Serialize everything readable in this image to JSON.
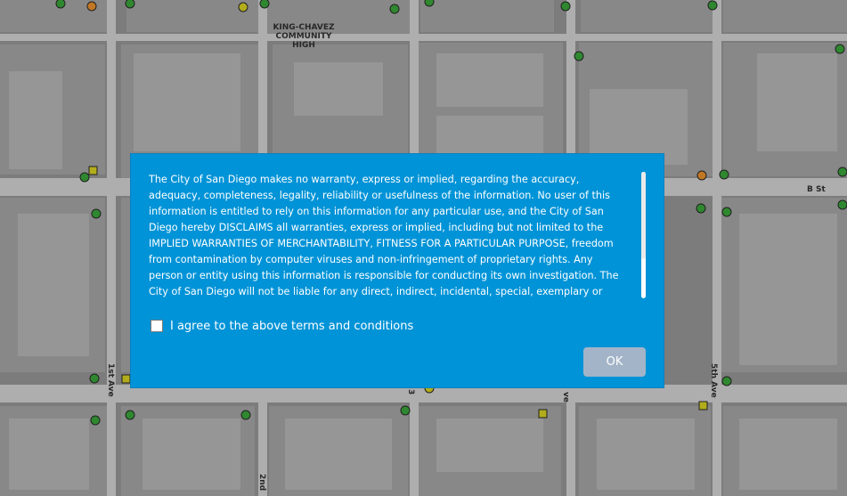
{
  "map": {
    "labels": {
      "school": [
        "KING-CHAVEZ",
        "COMMUNITY",
        "HIGH"
      ],
      "b_st": "B St",
      "first_ave": "1st Ave",
      "second_ave": "2nd",
      "fifth_ave": "5th Ave",
      "ave_fragment": "ve",
      "third_fragment": "3"
    },
    "colors": {
      "background": "#7d7d7d",
      "block": "#8a8a8a",
      "building": "#999999",
      "road": "#b3b3b3",
      "green_marker": "#2a8a2a",
      "orange_marker": "#c8781e",
      "yellow_marker": "#b8b214"
    }
  },
  "dialog": {
    "terms_text": "The City of San Diego makes no warranty, express or implied, regarding the accuracy, adequacy, completeness, legality, reliability or usefulness of the information. No user of this information is entitled to rely on this information for any particular use, and the City of San Diego hereby DISCLAIMS all warranties, express or implied, including but not limited to the IMPLIED WARRANTIES OF MERCHANTABILITY, FITNESS FOR A PARTICULAR PURPOSE, freedom from contamination by computer viruses and non-infringement of proprietary rights.  Any person or entity using this information is responsible for conducting its own investigation. The City of San Diego will not be liable for any direct, indirect, incidental, special, exemplary or consequential",
    "agree_label": "I agree to the above terms and conditions",
    "agree_checked": false,
    "ok_label": "OK",
    "colors": {
      "background": "#0093d7",
      "ok_button": "#a3b4c8",
      "text": "#ffffff"
    }
  }
}
